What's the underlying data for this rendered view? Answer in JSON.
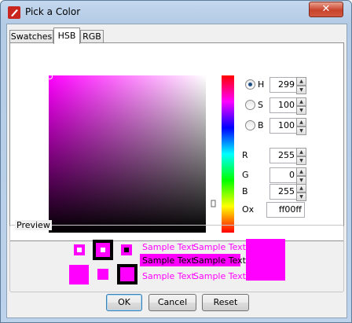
{
  "window": {
    "title": "Pick a Color",
    "close_glyph": "✕"
  },
  "tabs": [
    {
      "label": "Swatches",
      "active": false
    },
    {
      "label": "HSB",
      "active": true
    },
    {
      "label": "RGB",
      "active": false
    }
  ],
  "hsb": {
    "h_label": "H",
    "h_value": "299",
    "s_label": "S",
    "s_value": "100",
    "b_label": "B",
    "b_value": "100",
    "selected_mode": "H"
  },
  "rgb": {
    "r_label": "R",
    "r_value": "255",
    "g_label": "G",
    "g_value": "0",
    "b_label": "B",
    "b_value": "255",
    "hex_label": "Ox",
    "hex_value": "ff00ff"
  },
  "preview": {
    "legend": "Preview",
    "sample_text": "Sample Text",
    "color": "#ff00ff"
  },
  "buttons": {
    "ok": "OK",
    "cancel": "Cancel",
    "reset": "Reset"
  },
  "icons": {
    "app": "java-cup-icon",
    "spin_up": "▲",
    "spin_down": "▼"
  }
}
